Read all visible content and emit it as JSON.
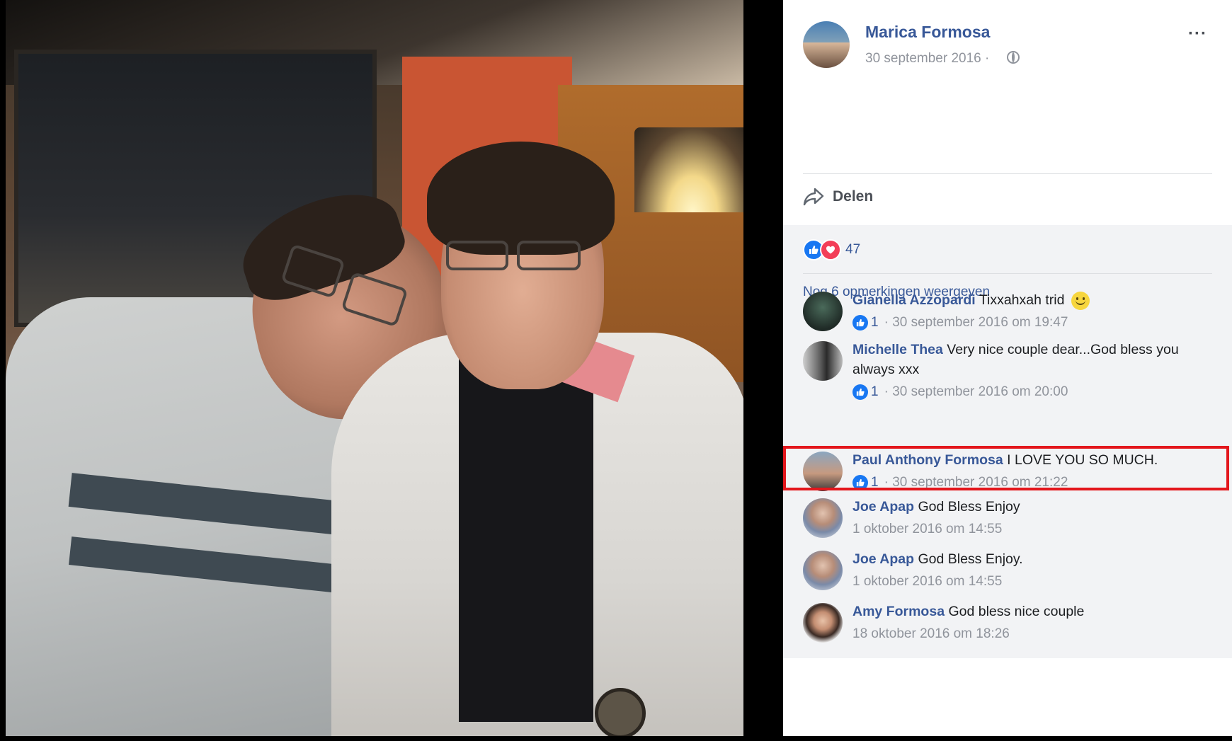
{
  "post": {
    "author": "Marica Formosa",
    "date": "30 september 2016 ·",
    "privacy_icon": "globe-icon",
    "more_icon": "···"
  },
  "actions": {
    "share_label": "Delen"
  },
  "reactions": {
    "count": "47",
    "types": [
      "like",
      "love"
    ]
  },
  "view_more": "Nog 6 opmerkingen weergeven",
  "comments": [
    {
      "name": "Gianella Azzopardi",
      "text": "Tixxahxah trid",
      "emoji": "smile",
      "likes": "1",
      "time": "30 september 2016 om 19:47"
    },
    {
      "name": "Michelle Thea",
      "text": "Very nice couple dear...God bless you always xxx",
      "likes": "1",
      "time": "30 september 2016 om 20:00"
    },
    {
      "name": "Paul Anthony Formosa",
      "text": "I LOVE YOU SO MUCH.",
      "likes": "1",
      "time": "30 september 2016 om 21:22",
      "highlighted": true
    },
    {
      "name": "Joe Apap",
      "text": "God Bless Enjoy",
      "likes": "",
      "time": "1 oktober 2016 om 14:55"
    },
    {
      "name": "Joe Apap",
      "text": "God Bless Enjoy.",
      "likes": "",
      "time": "1 oktober 2016 om 14:55"
    },
    {
      "name": "Amy Formosa",
      "text": "God bless nice couple",
      "likes": "",
      "time": "18 oktober 2016 om 18:26"
    }
  ],
  "colors": {
    "link": "#385898",
    "meta": "#90949c",
    "highlight": "#e3161c",
    "feedback_bg": "#f2f3f5"
  }
}
